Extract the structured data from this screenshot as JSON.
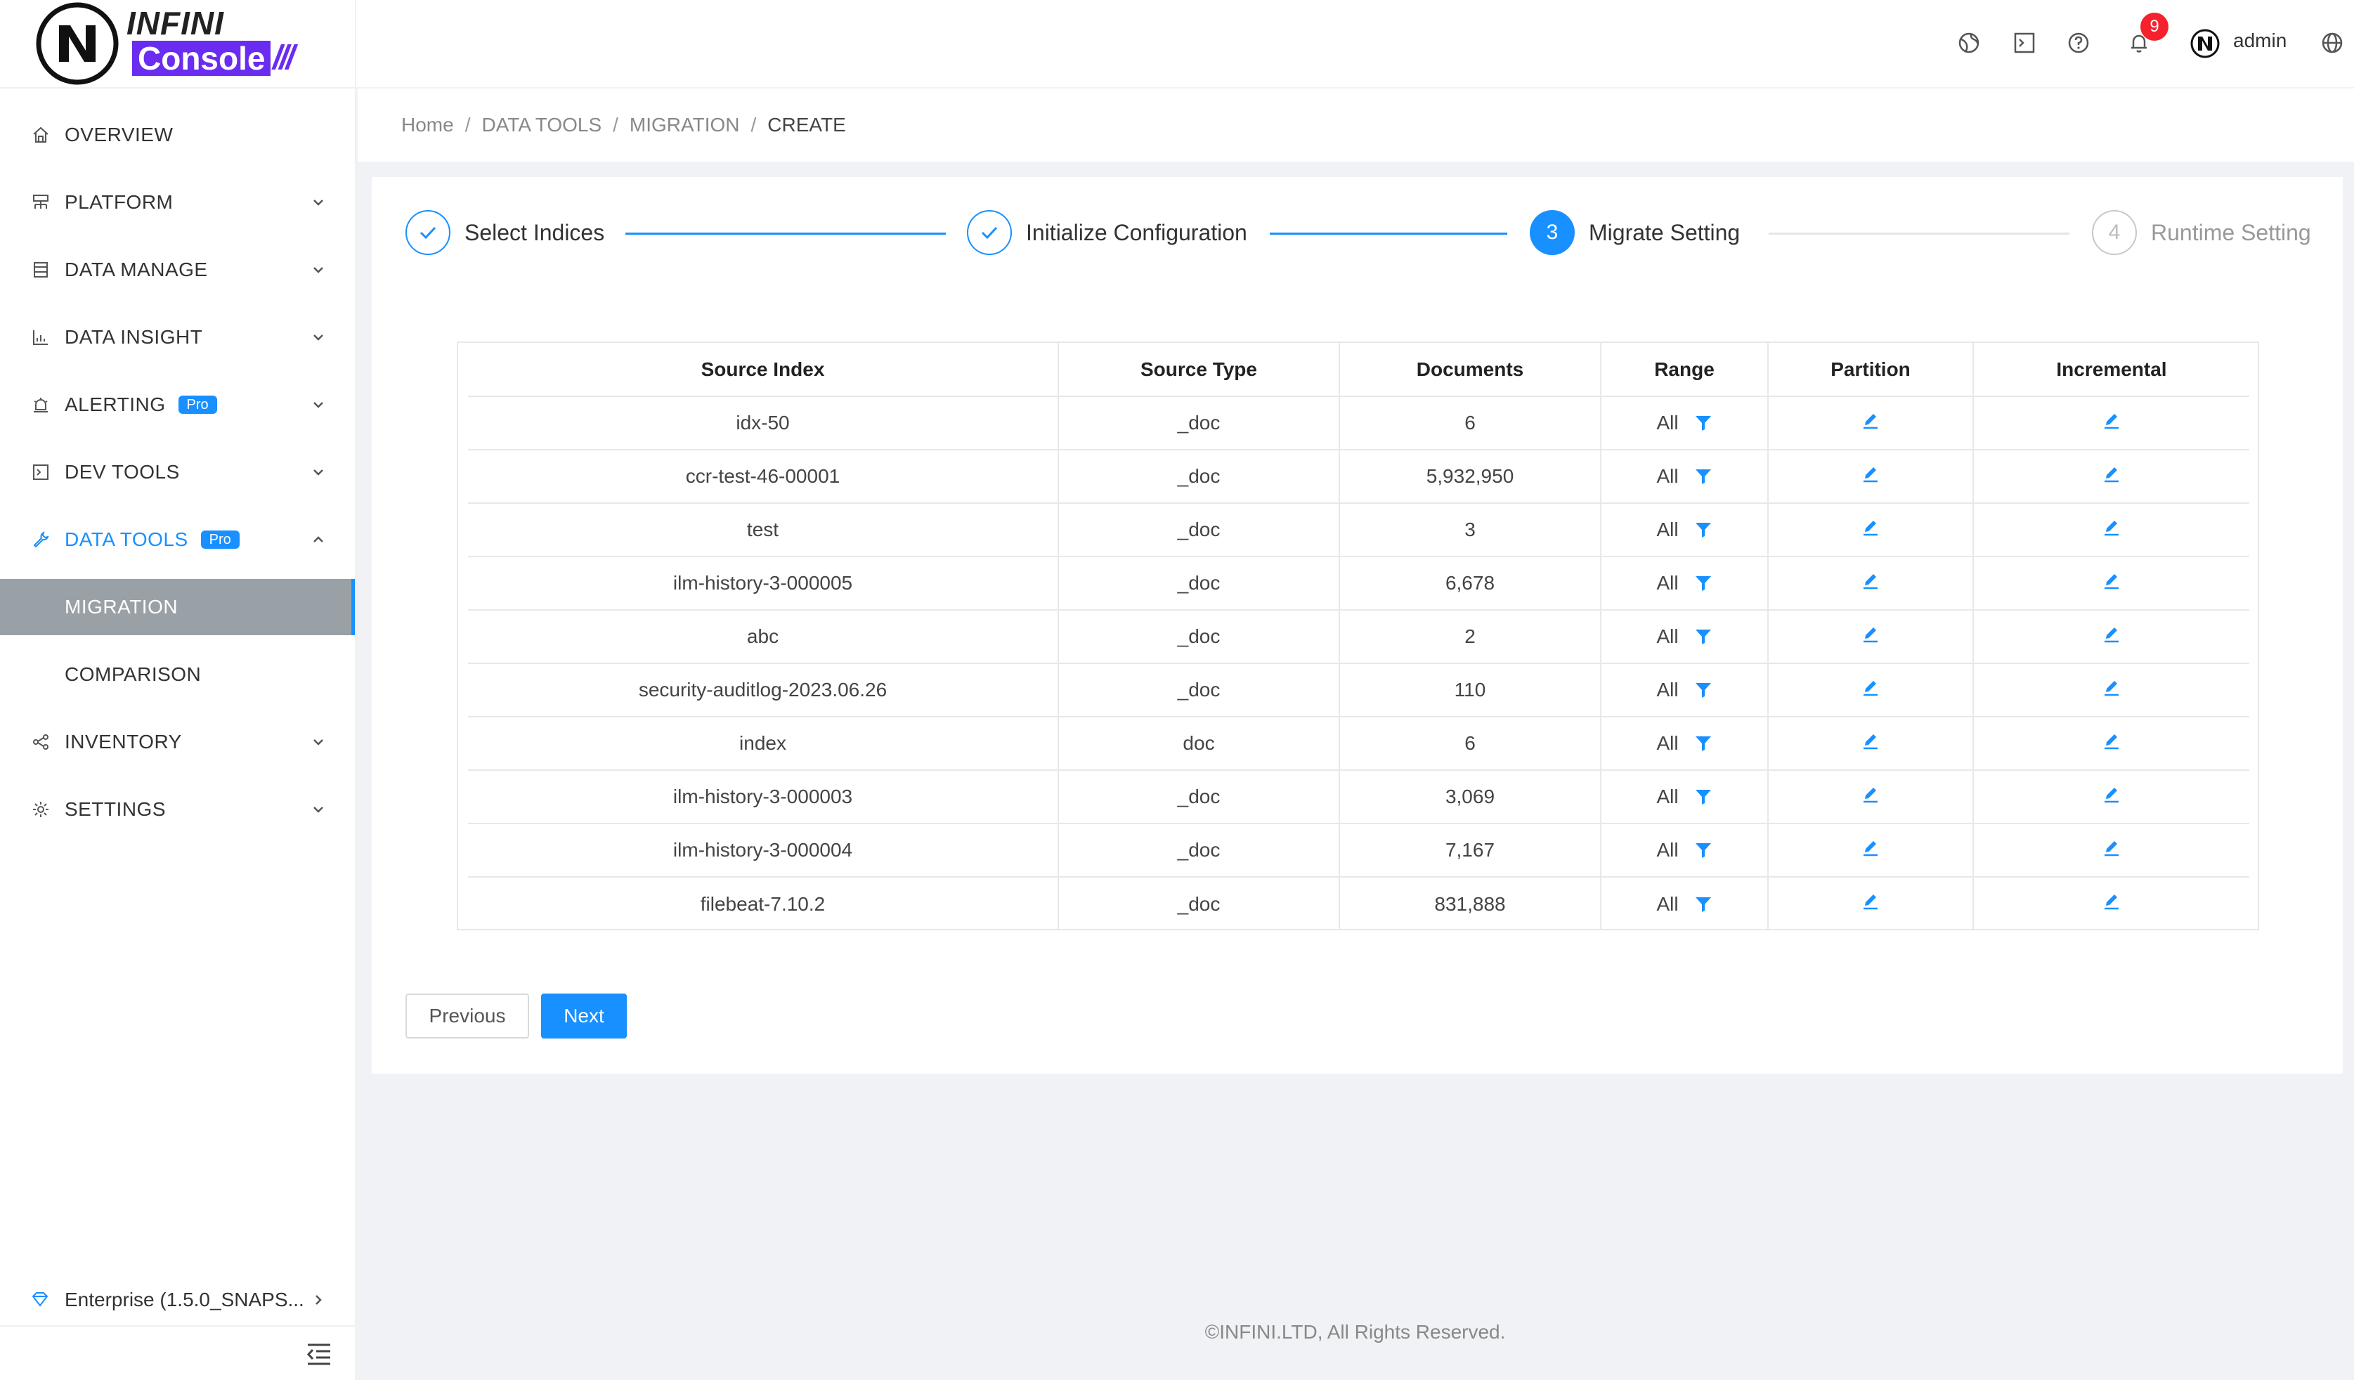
{
  "brand": {
    "word1": "INFINI",
    "word2": "Console",
    "slashes": "///"
  },
  "sidebar": {
    "items": [
      {
        "label": "OVERVIEW",
        "icon": "home-icon"
      },
      {
        "label": "PLATFORM",
        "icon": "platform-icon"
      },
      {
        "label": "DATA MANAGE",
        "icon": "database-icon"
      },
      {
        "label": "DATA INSIGHT",
        "icon": "chart-icon"
      },
      {
        "label": "ALERTING",
        "icon": "alert-icon",
        "badge": "Pro"
      },
      {
        "label": "DEV TOOLS",
        "icon": "terminal-icon"
      },
      {
        "label": "DATA TOOLS",
        "icon": "tool-icon",
        "badge": "Pro"
      },
      {
        "label": "MIGRATION"
      },
      {
        "label": "COMPARISON"
      },
      {
        "label": "INVENTORY",
        "icon": "share-icon"
      },
      {
        "label": "SETTINGS",
        "icon": "gear-icon"
      }
    ],
    "enterprise": "Enterprise (1.5.0_SNAPS..."
  },
  "header": {
    "notification_count": "9",
    "username": "admin"
  },
  "breadcrumb": [
    "Home",
    "DATA TOOLS",
    "MIGRATION",
    "CREATE"
  ],
  "steps": [
    {
      "title": "Select Indices",
      "status": "done"
    },
    {
      "title": "Initialize Configuration",
      "status": "done"
    },
    {
      "number": "3",
      "title": "Migrate Setting",
      "status": "active"
    },
    {
      "number": "4",
      "title": "Runtime Setting",
      "status": "wait"
    }
  ],
  "table": {
    "headers": [
      "Source Index",
      "Source Type",
      "Documents",
      "Range",
      "Partition",
      "Incremental"
    ],
    "rows": [
      {
        "index": "idx-50",
        "type": "_doc",
        "docs": "6",
        "range": "All"
      },
      {
        "index": "ccr-test-46-00001",
        "type": "_doc",
        "docs": "5,932,950",
        "range": "All"
      },
      {
        "index": "test",
        "type": "_doc",
        "docs": "3",
        "range": "All"
      },
      {
        "index": "ilm-history-3-000005",
        "type": "_doc",
        "docs": "6,678",
        "range": "All"
      },
      {
        "index": "abc",
        "type": "_doc",
        "docs": "2",
        "range": "All"
      },
      {
        "index": "security-auditlog-2023.06.26",
        "type": "_doc",
        "docs": "110",
        "range": "All"
      },
      {
        "index": "index",
        "type": "doc",
        "docs": "6",
        "range": "All"
      },
      {
        "index": "ilm-history-3-000003",
        "type": "_doc",
        "docs": "3,069",
        "range": "All"
      },
      {
        "index": "ilm-history-3-000004",
        "type": "_doc",
        "docs": "7,167",
        "range": "All"
      },
      {
        "index": "filebeat-7.10.2",
        "type": "_doc",
        "docs": "831,888",
        "range": "All"
      }
    ]
  },
  "buttons": {
    "previous": "Previous",
    "next": "Next"
  },
  "footer": "©INFINI.LTD, All Rights Reserved.",
  "colors": {
    "primary": "#1890ff",
    "brand": "#6a2cf0",
    "badge": "#f5222d"
  }
}
